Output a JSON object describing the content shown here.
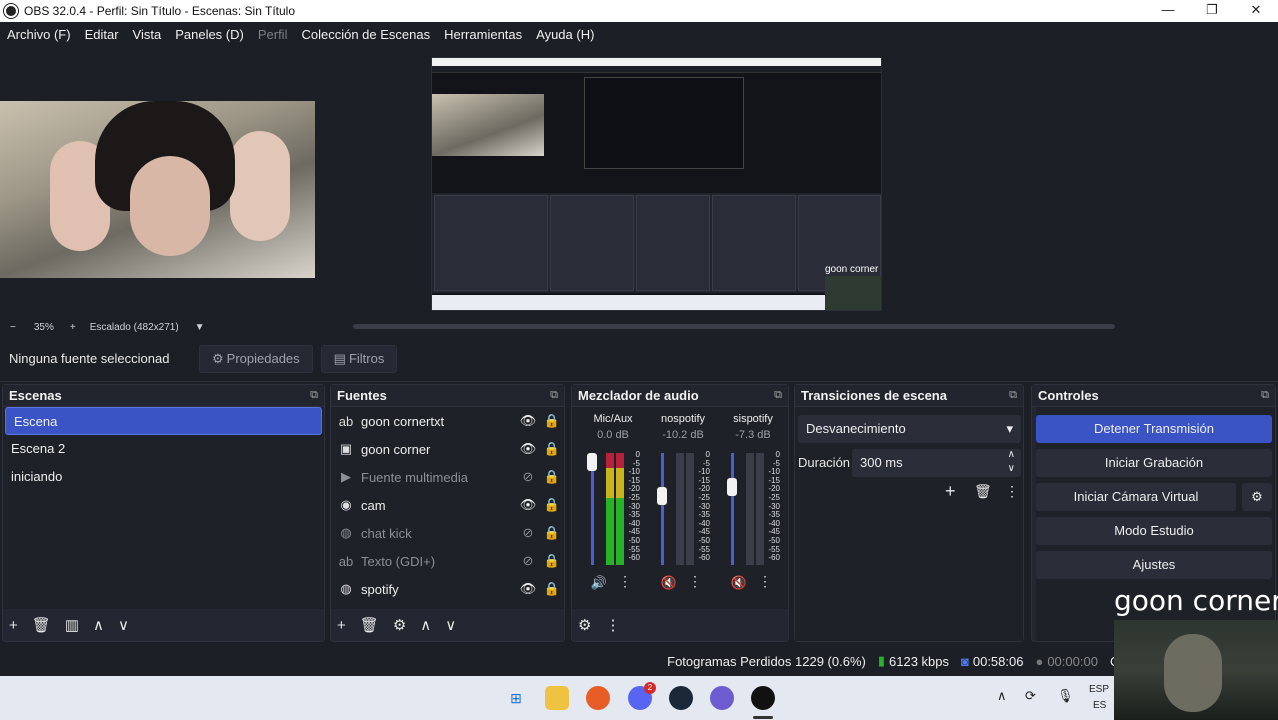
{
  "window": {
    "title": "OBS 32.0.4 - Perfil: Sin Título - Escenas: Sin Título",
    "min": "—",
    "max": "❐",
    "close": "✕"
  },
  "menu": [
    "Archivo (F)",
    "Editar",
    "Vista",
    "Paneles (D)",
    "Perfil",
    "Colección de Escenas",
    "Herramientas",
    "Ayuda (H)"
  ],
  "preview": {
    "overlay_label": "goon corner"
  },
  "zoom": {
    "minus": "−",
    "percent": "35%",
    "plus": "+",
    "scale": "Escalado (482x271)"
  },
  "context": {
    "no_source": "Ninguna fuente seleccionada",
    "properties": "Propiedades",
    "filters": "Filtros"
  },
  "scenes": {
    "title": "Escenas",
    "items": [
      "Escena",
      "Escena 2",
      "iniciando"
    ]
  },
  "sources": {
    "title": "Fuentes",
    "items": [
      {
        "name": "goon cornertxt",
        "icon": "text-icon",
        "visible": true
      },
      {
        "name": "goon corner",
        "icon": "image-icon",
        "visible": true
      },
      {
        "name": "Fuente multimedia",
        "icon": "media-icon",
        "visible": false
      },
      {
        "name": "cam",
        "icon": "camera-icon",
        "visible": true
      },
      {
        "name": "chat kick",
        "icon": "browser-icon",
        "visible": false
      },
      {
        "name": "Texto (GDI+)",
        "icon": "text-icon",
        "visible": false
      },
      {
        "name": "spotify",
        "icon": "browser-icon",
        "visible": true
      }
    ]
  },
  "mixer": {
    "title": "Mezclador de audio",
    "channels": [
      {
        "name": "Mic/Aux",
        "db": "0.0 dB",
        "muted": false,
        "level": 0.95,
        "slider": 0.92
      },
      {
        "name": "nospotify",
        "db": "-10.2 dB",
        "muted": true,
        "level": 0.0,
        "slider": 0.62
      },
      {
        "name": "sispotify",
        "db": "-7.3 dB",
        "muted": true,
        "level": 0.0,
        "slider": 0.7
      }
    ],
    "ticks": [
      "0",
      "-5",
      "-10",
      "-15",
      "-20",
      "-25",
      "-30",
      "-35",
      "-40",
      "-45",
      "-50",
      "-55",
      "-60"
    ]
  },
  "transitions": {
    "title": "Transiciones de escena",
    "type": "Desvanecimiento",
    "duration_label": "Duración",
    "duration": "300 ms"
  },
  "controls": {
    "title": "Controles",
    "stop_stream": "Detener Transmisión",
    "start_record": "Iniciar Grabación",
    "start_vcam": "Iniciar Cámara Virtual",
    "studio": "Modo Estudio",
    "settings": "Ajustes"
  },
  "status": {
    "dropped": "Fotogramas Perdidos 1229 (0.6%)",
    "bitrate": "6123 kbps",
    "stream_time": "00:58:06",
    "rec_time": "00:00:00",
    "cpu": "CP"
  },
  "tray": {
    "lang": "ESP",
    "region": "ES",
    "discord_badge": "2"
  },
  "overlay": {
    "text": "goon corner"
  },
  "colors": {
    "accent": "#3a54c6",
    "mute_red": "#d0203a",
    "meter_green": "#27b327",
    "meter_yellow": "#c8b51e",
    "meter_red": "#b8213a"
  }
}
